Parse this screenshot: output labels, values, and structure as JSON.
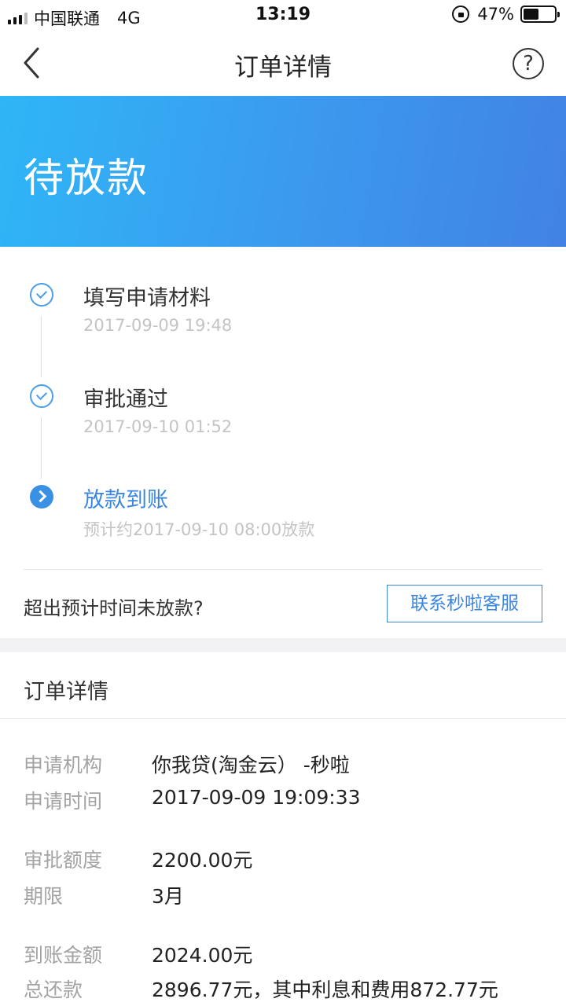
{
  "status_bar": {
    "carrier": "中国联通",
    "network": "4G",
    "time": "13:19",
    "battery": "47%"
  },
  "nav": {
    "title": "订单详情",
    "help_symbol": "?"
  },
  "banner": {
    "status": "待放款",
    "gradient_start": "#2fb6f7",
    "gradient_end": "#4182e4"
  },
  "timeline": {
    "steps": [
      {
        "title": "填写申请材料",
        "subtitle": "2017-09-09 19:48",
        "state": "done"
      },
      {
        "title": "审批通过",
        "subtitle": "2017-09-10 01:52",
        "state": "done"
      },
      {
        "title": "放款到账",
        "subtitle": "预计约2017-09-10 08:00放款",
        "state": "current"
      }
    ],
    "overdue_prompt": "超出预计时间未放款?",
    "contact_button": "联系秒啦客服"
  },
  "details": {
    "header": "订单详情",
    "rows": [
      {
        "label": "申请机构",
        "value": "你我贷(淘金云） -秒啦"
      },
      {
        "label": "申请时间",
        "value": "2017-09-09 19:09:33"
      },
      {
        "label": "审批额度",
        "value": "2200.00元"
      },
      {
        "label": "期限",
        "value": "3月"
      },
      {
        "label": "到账金额",
        "value": "2024.00元"
      },
      {
        "label": "总还款",
        "value": "2896.77元，其中利息和费用872.77元"
      }
    ]
  },
  "colors": {
    "accent": "#3a86e0",
    "muted_text": "#a3a3a3"
  }
}
